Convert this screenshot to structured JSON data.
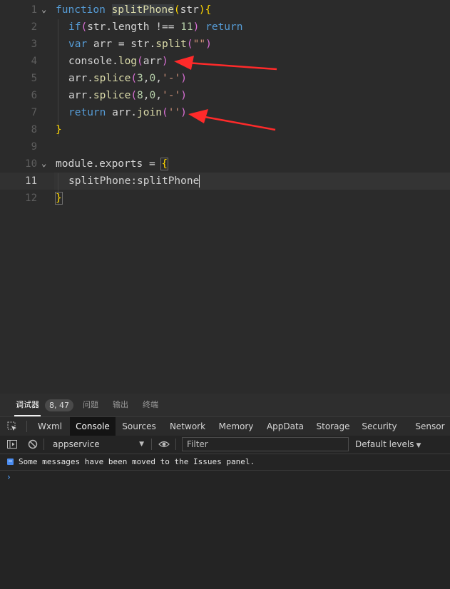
{
  "editor": {
    "lines": [
      {
        "num": "1",
        "fold": "⌄"
      },
      {
        "num": "2"
      },
      {
        "num": "3"
      },
      {
        "num": "4"
      },
      {
        "num": "5"
      },
      {
        "num": "6"
      },
      {
        "num": "7"
      },
      {
        "num": "8"
      },
      {
        "num": "9"
      },
      {
        "num": "10",
        "fold": "⌄"
      },
      {
        "num": "11"
      },
      {
        "num": "12"
      }
    ],
    "tokens": {
      "l1_kw": "function",
      "l1_name": "splitPhone",
      "l1_open": "(",
      "l1_param": "str",
      "l1_close": ")",
      "l1_brace": "{",
      "l2_if": "if",
      "l2_open": "(",
      "l2_expr": "str.length !== ",
      "l2_num": "11",
      "l2_close": ")",
      "l2_ret": " return",
      "l3_var": "var",
      "l3_rest": " arr = str.",
      "l3_fn": "split",
      "l3_open": "(",
      "l3_str": "\"\"",
      "l3_close": ")",
      "l4_obj": "console.",
      "l4_fn": "log",
      "l4_open": "(",
      "l4_arg": "arr",
      "l4_close": ")",
      "l5_obj": "arr.",
      "l5_fn": "splice",
      "l5_open": "(",
      "l5_n1": "3",
      "l5_c1": ",",
      "l5_n2": "0",
      "l5_c2": ",",
      "l5_str": "'-'",
      "l5_close": ")",
      "l6_obj": "arr.",
      "l6_fn": "splice",
      "l6_open": "(",
      "l6_n1": "8",
      "l6_c1": ",",
      "l6_n2": "0",
      "l6_c2": ",",
      "l6_str": "'-'",
      "l6_close": ")",
      "l7_ret": "return",
      "l7_obj": " arr.",
      "l7_fn": "join",
      "l7_open": "(",
      "l7_str": "''",
      "l7_close": ")",
      "l8_brace": "}",
      "l10_mod": "module.exports",
      "l10_eq": " = ",
      "l10_brace": "{",
      "l11_key": "splitPhone",
      "l11_colon": ":",
      "l11_val": "splitPhone",
      "l12_brace": "}"
    }
  },
  "devtools": {
    "top_tabs": [
      "调试器",
      "问题",
      "输出",
      "终端"
    ],
    "position_badge": "8, 47",
    "panel_tabs": [
      "Wxml",
      "Console",
      "Sources",
      "Network",
      "Memory",
      "AppData",
      "Storage",
      "Security",
      "Sensor"
    ],
    "active_panel": "Console",
    "context": "appservice",
    "filter_placeholder": "Filter",
    "levels": "Default levels",
    "messages": [
      "Some messages have been moved to the Issues panel."
    ],
    "prompt": "›"
  },
  "colors": {
    "annotation_arrow": "#ff2a2a",
    "accent": "#4a8cf0"
  }
}
